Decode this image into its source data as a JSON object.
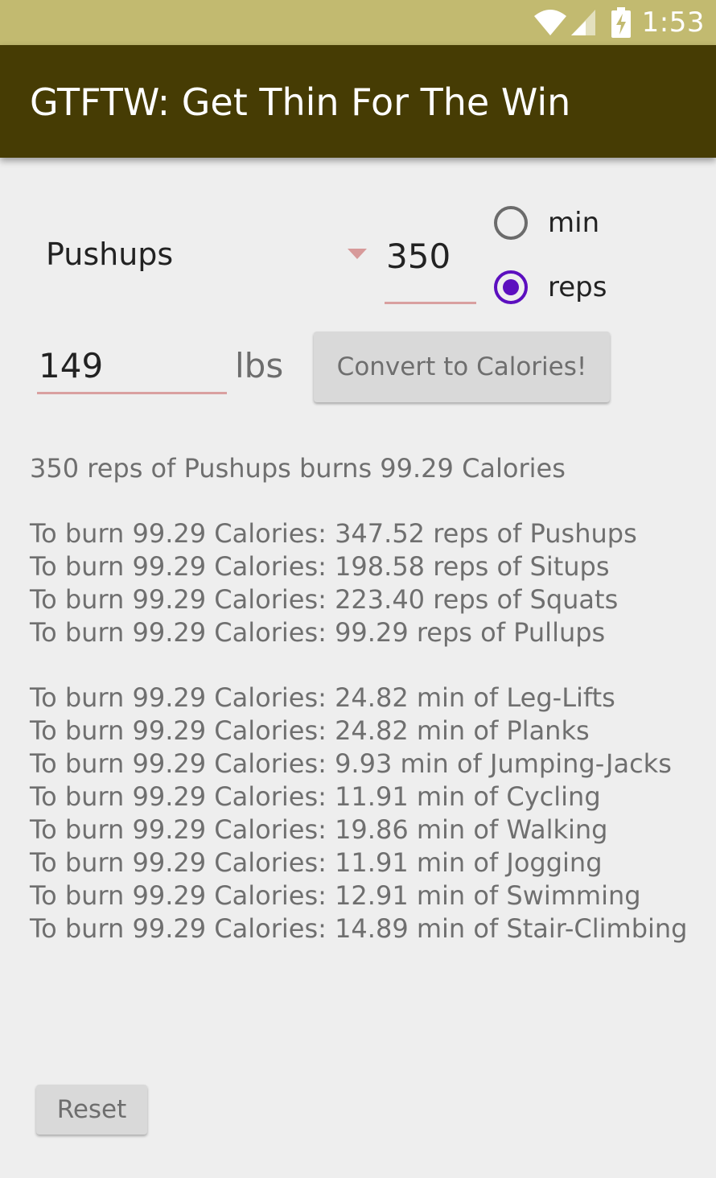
{
  "status_bar": {
    "time": "1:53",
    "icons": [
      "wifi-icon",
      "signal-icon",
      "battery-charging-icon"
    ]
  },
  "app_bar": {
    "title": "GTFTW: Get Thin For The Win"
  },
  "form": {
    "exercise_selected": "Pushups",
    "amount": "350",
    "unit_options": [
      {
        "label": "min",
        "selected": false
      },
      {
        "label": "reps",
        "selected": true
      }
    ],
    "weight": "149",
    "weight_unit": "lbs",
    "convert_label": "Convert to Calories!"
  },
  "results": {
    "summary": "350 reps of Pushups burns 99.29 Calories",
    "reps_lines": [
      "To burn 99.29 Calories: 347.52 reps of Pushups",
      "To burn 99.29 Calories: 198.58 reps of Situps",
      "To burn 99.29 Calories: 223.40 reps of Squats",
      "To burn 99.29 Calories: 99.29 reps of Pullups"
    ],
    "min_lines": [
      "To burn 99.29 Calories: 24.82 min of Leg-Lifts",
      "To burn 99.29 Calories: 24.82 min of Planks",
      "To burn 99.29 Calories: 9.93 min of Jumping-Jacks",
      "To burn 99.29 Calories: 11.91 min of Cycling",
      "To burn 99.29 Calories: 19.86 min of Walking",
      "To burn 99.29 Calories: 11.91 min of Jogging",
      "To burn 99.29 Calories: 12.91 min of Swimming",
      "To burn 99.29 Calories: 14.89 min of Stair-Climbing"
    ]
  },
  "reset_label": "Reset",
  "colors": {
    "status_bar": "#c2ba70",
    "app_bar": "#463c04",
    "accent_radio": "#5c0fbf",
    "field_underline": "#d9a0a0",
    "background": "#eeeeee"
  }
}
